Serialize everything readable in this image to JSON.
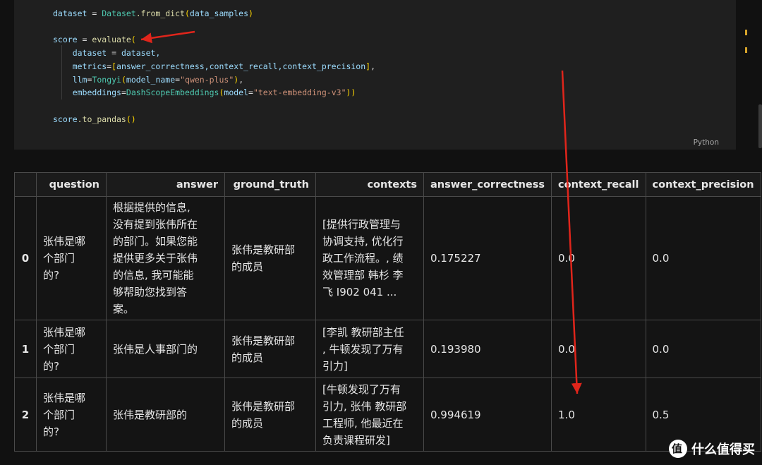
{
  "code": {
    "line1": {
      "var": "dataset",
      "op": " = ",
      "cls": "Dataset",
      "method": ".from_dict",
      "arg": "data_samples"
    },
    "line2": {
      "var": "score",
      "op": " = ",
      "fn": "evaluate"
    },
    "line3": {
      "param": "dataset",
      "op": " = ",
      "value": "dataset,"
    },
    "line4": {
      "param": "metrics",
      "value": "answer_correctness,context_recall,context_precision"
    },
    "line5": {
      "param": "llm",
      "cls": "Tongyi",
      "param2": "model_name",
      "str": "\"qwen-plus\""
    },
    "line6": {
      "param": "embeddings",
      "cls": "DashScopeEmbeddings",
      "param2": "model",
      "str": "\"text-embedding-v3\""
    },
    "line7": {
      "var": "score",
      "method": ".to_pandas"
    },
    "language": "Python"
  },
  "table": {
    "columns": [
      "",
      "question",
      "answer",
      "ground_truth",
      "contexts",
      "answer_correctness",
      "context_recall",
      "context_precision"
    ],
    "rows": [
      {
        "index": "0",
        "question": "张伟是哪\n个部门\n的?",
        "answer": "根据提供的信息,\n没有提到张伟所在\n的部门。如果您能\n提供更多关于张伟\n的信息, 我可能能\n够帮助您找到答\n案。",
        "ground_truth": "张伟是教研部\n的成员",
        "contexts": "[提供行政管理与\n协调支持, 优化行\n政工作流程。, 绩\n效管理部 韩杉 李\n飞 I902 041 ...",
        "answer_correctness": "0.175227",
        "context_recall": "0.0",
        "context_precision": "0.0"
      },
      {
        "index": "1",
        "question": "张伟是哪\n个部门\n的?",
        "answer": "张伟是人事部门的",
        "ground_truth": "张伟是教研部\n的成员",
        "contexts": "[李凯 教研部主任\n, 牛顿发现了万有\n引力]",
        "answer_correctness": "0.193980",
        "context_recall": "0.0",
        "context_precision": "0.0"
      },
      {
        "index": "2",
        "question": "张伟是哪\n个部门\n的?",
        "answer": "张伟是教研部的",
        "ground_truth": "张伟是教研部\n的成员",
        "contexts": "[牛顿发现了万有\n引力, 张伟 教研部\n工程师, 他最近在\n负责课程研发]",
        "answer_correctness": "0.994619",
        "context_recall": "1.0",
        "context_precision": "0.5"
      }
    ]
  },
  "watermark": {
    "text": "什么值得买"
  },
  "colors": {
    "arrow": "#e0251b",
    "accent_marker": "#d7a42a"
  }
}
